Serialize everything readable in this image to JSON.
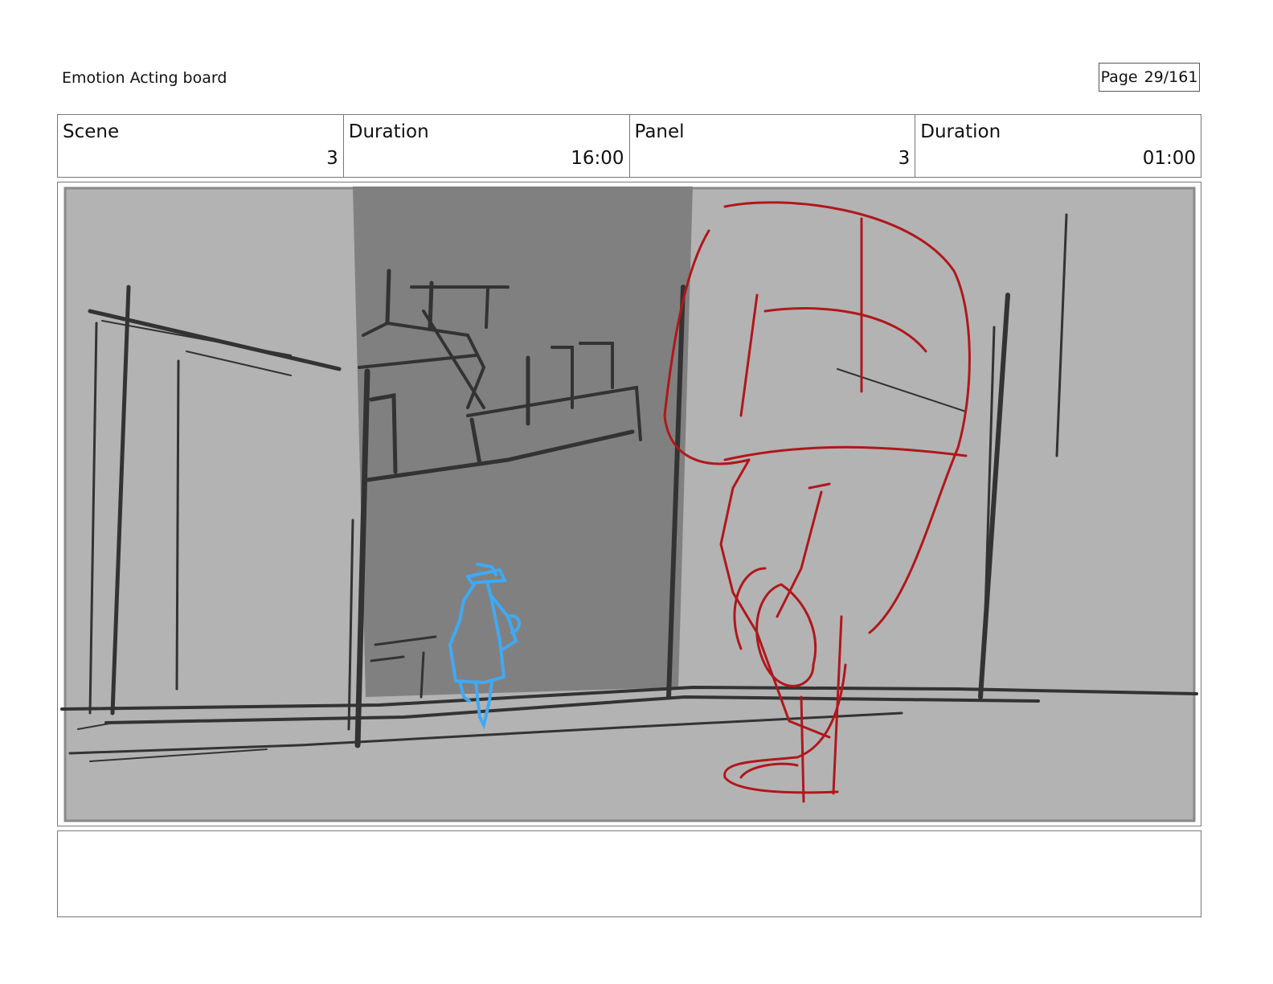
{
  "header": {
    "board_title": "Emotion Acting board",
    "page_label": "Page",
    "page_number": "29/161"
  },
  "info": {
    "scene_label": "Scene",
    "scene_value": "3",
    "scene_duration_label": "Duration",
    "scene_duration_value": "16:00",
    "panel_label": "Panel",
    "panel_value": "3",
    "panel_duration_label": "Duration",
    "panel_duration_value": "01:00"
  },
  "panel_sketch": {
    "colors": {
      "background": "#b3b3b3",
      "shadow": "#808080",
      "ink": "#333333",
      "foreground_character": "#b0171b",
      "background_character": "#3fa9f5"
    }
  },
  "notes": {
    "text": ""
  }
}
